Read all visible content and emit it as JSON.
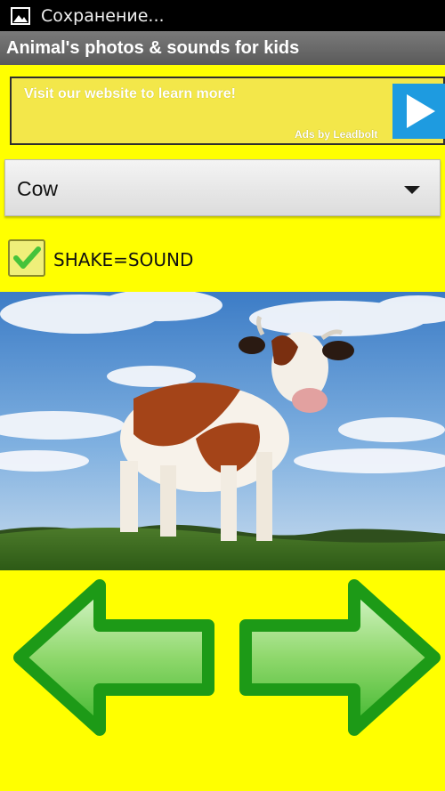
{
  "status_bar": {
    "text": "Сохранение...",
    "icon": "image-icon"
  },
  "title_bar": {
    "title": "Animal's photos & sounds for kids"
  },
  "ad": {
    "text": "Visit our website to learn more!",
    "attribution": "Ads by Leadbolt",
    "button_icon": "play-icon"
  },
  "spinner": {
    "selected": "Cow",
    "icon": "dropdown-arrow-icon"
  },
  "shake_option": {
    "label": "SHAKE=SOUND",
    "checked": true
  },
  "photo": {
    "subject": "cow"
  },
  "navigation": {
    "prev_icon": "arrow-left-icon",
    "next_icon": "arrow-right-icon"
  },
  "colors": {
    "background": "#ffff00",
    "ad_background": "#f3e74a",
    "ad_button": "#1e9be0",
    "arrow_fill": "#7fd24e",
    "arrow_outline": "#1d9a17"
  }
}
